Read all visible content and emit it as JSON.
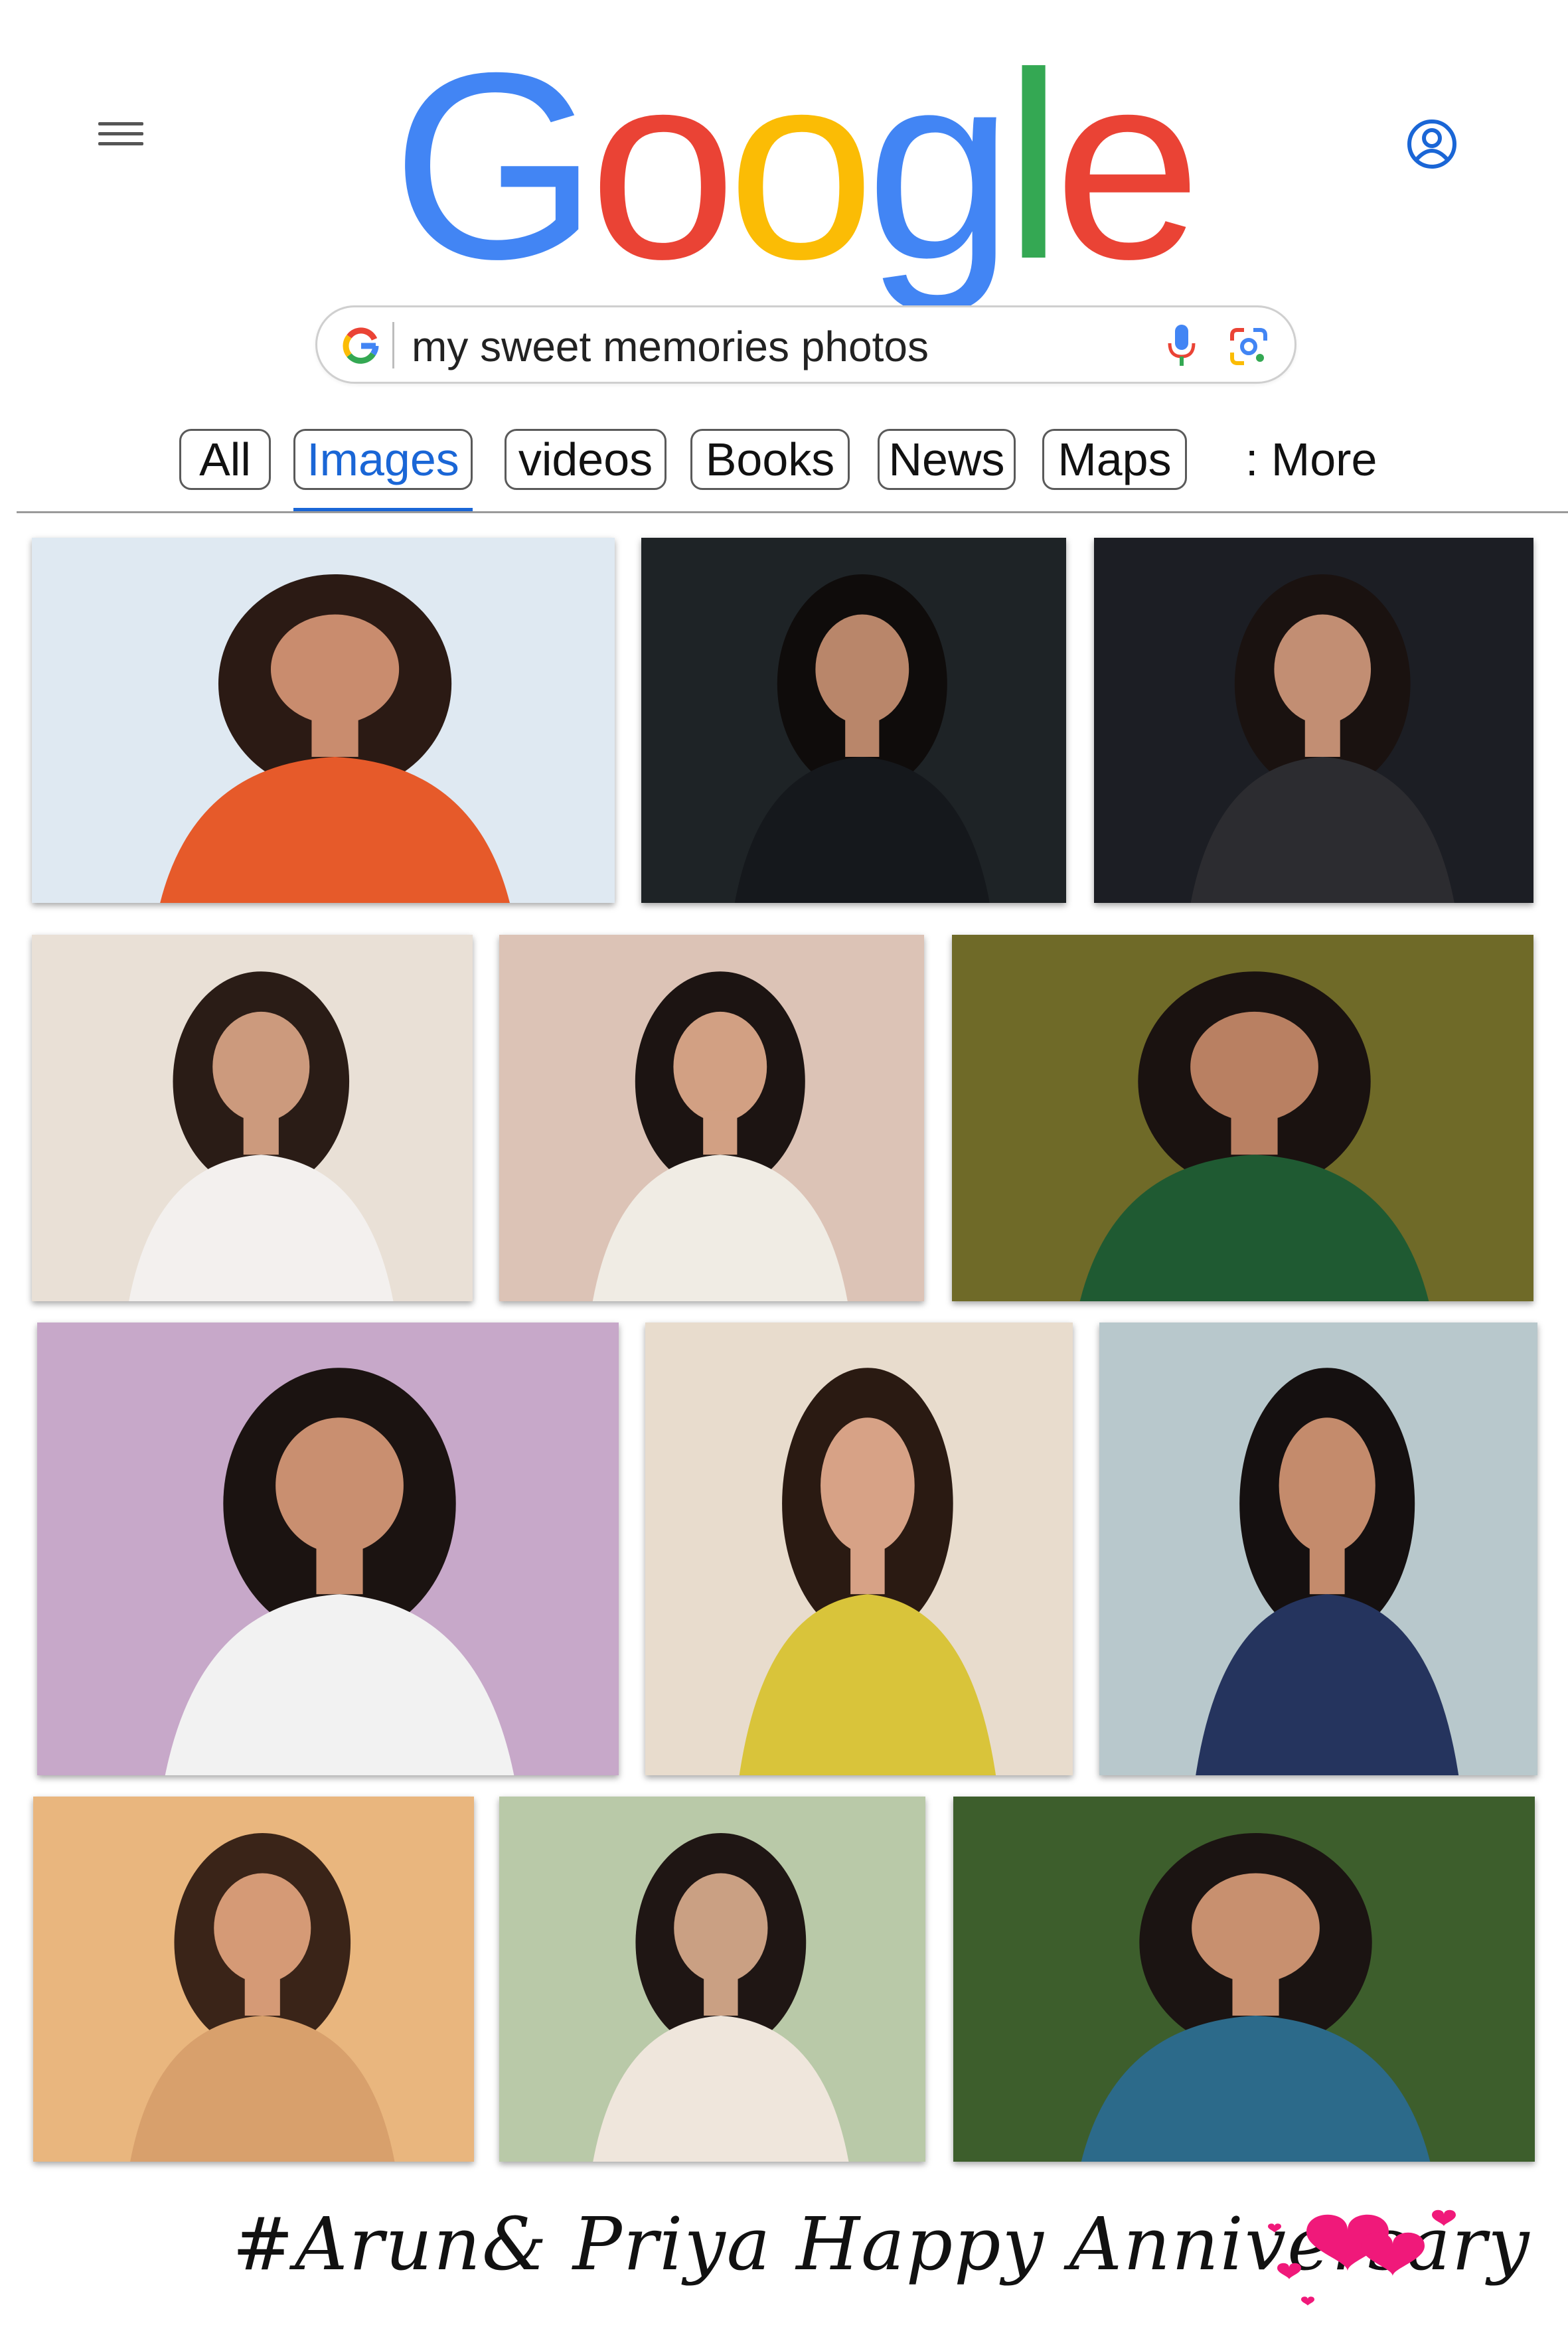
{
  "header": {
    "logo_letters": [
      "G",
      "o",
      "o",
      "g",
      "l",
      "e"
    ],
    "logo_colors": [
      "#4285F4",
      "#EA4335",
      "#FBBC05",
      "#4285F4",
      "#34A853",
      "#EA4335"
    ],
    "menu_icon": "hamburger-menu-icon",
    "account_icon": "account-circle-icon"
  },
  "search": {
    "query": "my sweet memories photos",
    "icons": [
      "google-g-icon",
      "microphone-icon",
      "google-lens-icon"
    ]
  },
  "tabs": [
    {
      "label": "All",
      "active": false
    },
    {
      "label": "Images",
      "active": true
    },
    {
      "label": "videos",
      "active": false
    },
    {
      "label": "Books",
      "active": false
    },
    {
      "label": "News",
      "active": false
    },
    {
      "label": "Maps",
      "active": false
    }
  ],
  "more_label": ": More",
  "accent_color": "#1a66d6",
  "results": [
    {
      "name": "image-result-1",
      "bg": "#dfe9f2",
      "accent": "#e65a2a",
      "hair": "#2b1a14",
      "skin": "#c98c6e"
    },
    {
      "name": "image-result-2",
      "bg": "#1e2326",
      "accent": "#15181c",
      "hair": "#0f0c0b",
      "skin": "#b9866a"
    },
    {
      "name": "image-result-3",
      "bg": "#1c1e24",
      "accent": "#2c2c30",
      "hair": "#1a1210",
      "skin": "#c28e73"
    },
    {
      "name": "image-result-4",
      "bg": "#e9e0d6",
      "accent": "#f3f0ee",
      "hair": "#2a1c16",
      "skin": "#cc9a7d"
    },
    {
      "name": "image-result-5",
      "bg": "#dcc3b6",
      "accent": "#f0ece4",
      "hair": "#1c1412",
      "skin": "#d2a083"
    },
    {
      "name": "image-result-6",
      "bg": "#6f6a28",
      "accent": "#1f5a32",
      "hair": "#1a1210",
      "skin": "#b98062"
    },
    {
      "name": "image-result-7",
      "bg": "#c7a8c9",
      "accent": "#f2f2f2",
      "hair": "#1b1311",
      "skin": "#c98f70"
    },
    {
      "name": "image-result-8",
      "bg": "#e8dccd",
      "accent": "#d9c43a",
      "hair": "#2a1a12",
      "skin": "#d7a286"
    },
    {
      "name": "image-result-9",
      "bg": "#b8c8cc",
      "accent": "#25345e",
      "hair": "#151010",
      "skin": "#c48b6c"
    },
    {
      "name": "image-result-10",
      "bg": "#e9b67e",
      "accent": "#d8a06c",
      "hair": "#3a2418",
      "skin": "#d59a76"
    },
    {
      "name": "image-result-11",
      "bg": "#b9c9a8",
      "accent": "#efe6dc",
      "hair": "#1f1614",
      "skin": "#caa083"
    },
    {
      "name": "image-result-12",
      "bg": "#3d5e2c",
      "accent": "#2c6a8a",
      "hair": "#1b1412",
      "skin": "#c8906f"
    }
  ],
  "caption": "#Arun& Priya Happy Anniversary",
  "hearts_color": "#f0197a"
}
